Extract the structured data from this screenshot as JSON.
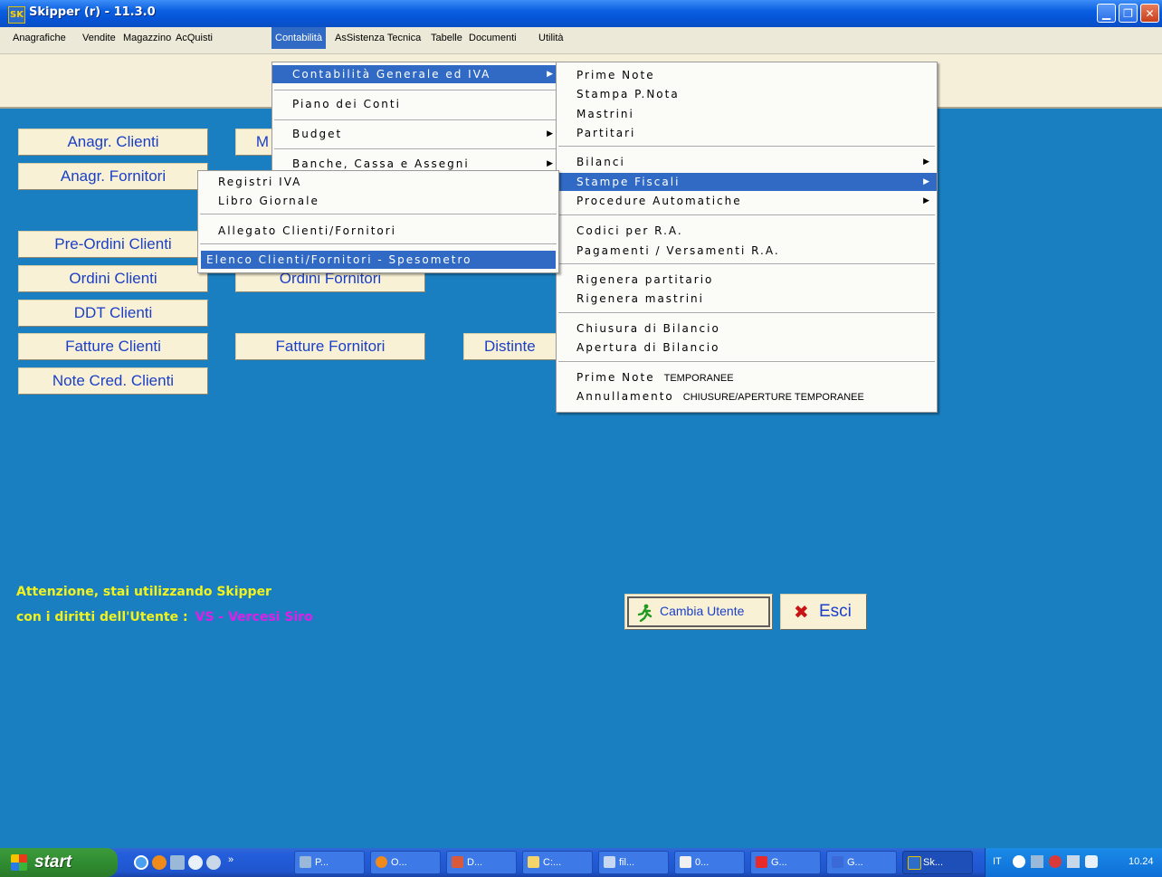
{
  "window": {
    "title": "Skipper (r) - 11.3.0",
    "icon": "app-icon",
    "minimize": "▁",
    "restore": "❐",
    "close": "✕"
  },
  "menubar": {
    "items": [
      "Anagrafiche",
      "Vendite",
      "Magazzino",
      "AcQuisti",
      "Contabilità",
      "AsSistenza Tecnica",
      "Tabelle",
      "Documenti",
      "Utilità"
    ],
    "active": "Contabilità"
  },
  "buttons": {
    "anagr_clienti": "Anagr. Clienti",
    "m_partial": "M",
    "anagr_fornitori": "Anagr. Fornitori",
    "pre_ordini_clienti": "Pre-Ordini Clienti",
    "ordini_clienti": "Ordini Clienti",
    "ordini_fornitori": "Ordini Fornitori",
    "ddt_clienti": "DDT Clienti",
    "fatture_clienti": "Fatture Clienti",
    "fatture_fornitori": "Fatture Fornitori",
    "distinte_partial": "Distinte",
    "note_cred_clienti": "Note Cred. Clienti"
  },
  "menu_contabilita": {
    "items": [
      "Contabilità Generale ed IVA",
      "Piano dei Conti",
      "Budget",
      "Banche, Cassa e Assegni"
    ]
  },
  "menu_contabilita_generale": {
    "items": [
      "Prime Note",
      "Stampa P.Nota",
      "Mastrini",
      "Partitari",
      "Bilanci",
      "Stampe Fiscali",
      "Procedure Automatiche",
      "Codici per R.A.",
      "Pagamenti / Versamenti R.A.",
      "Rigenera partitario",
      "Rigenera mastrini",
      "Chiusura di Bilancio",
      "Apertura di Bilancio",
      "Prime Note",
      "Annullamento"
    ],
    "small": {
      "temporanee": "TEMPORANEE",
      "chiusure": "CHIUSURE/APERTURE TEMPORANEE"
    }
  },
  "menu_stampe_fiscali": {
    "items": [
      "Registri IVA",
      "Libro Giornale",
      "Allegato Clienti/Fornitori",
      "Elenco Clienti/Fornitori - Spesometro"
    ]
  },
  "warning": {
    "line1": "Attenzione, stai utilizzando Skipper",
    "line2": "con i diritti dell'Utente :",
    "user": "VS  -  Vercesi Siro"
  },
  "dialog": {
    "cambia_utente": "Cambia Utente",
    "esci": "Esci"
  },
  "taskbar": {
    "start": "start",
    "items": [
      "P...",
      "O...",
      "D...",
      "C:...",
      "fil...",
      "0...",
      "G...",
      "G...",
      "Sk..."
    ],
    "lang": "IT",
    "clock": "10.24",
    "chevron": "»"
  },
  "colors": {
    "desktop": "#1a7fc0",
    "accent": "#316ac5",
    "button_text": "#1a3fc8",
    "warning": "#f2f21c",
    "user": "#e01ee8"
  }
}
